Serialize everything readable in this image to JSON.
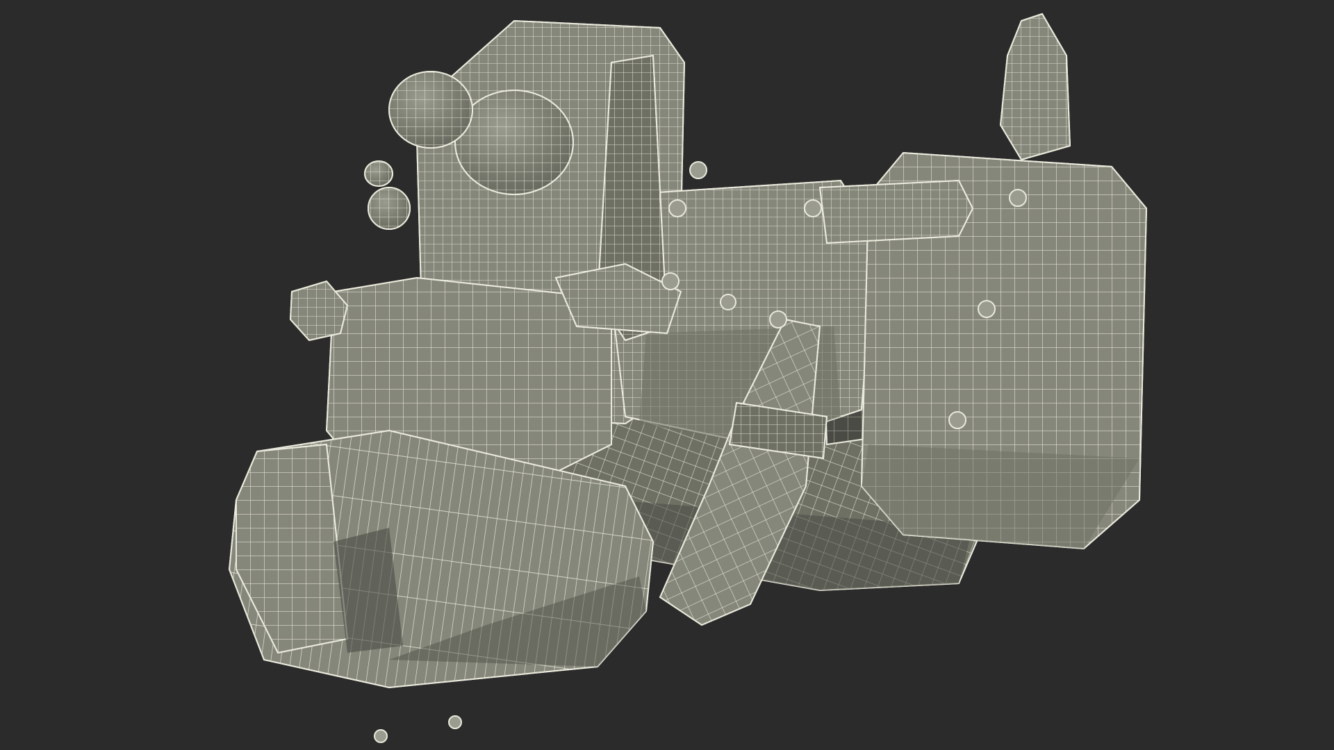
{
  "scene": {
    "background_color": "#2b2b2b",
    "solid_color": "#85877a",
    "solid_dark_color": "#6e7064",
    "shadow_color": "#4a4b44",
    "wire_color": "#e9e9dc",
    "subject_icon": "engine-wireframe-icon"
  }
}
